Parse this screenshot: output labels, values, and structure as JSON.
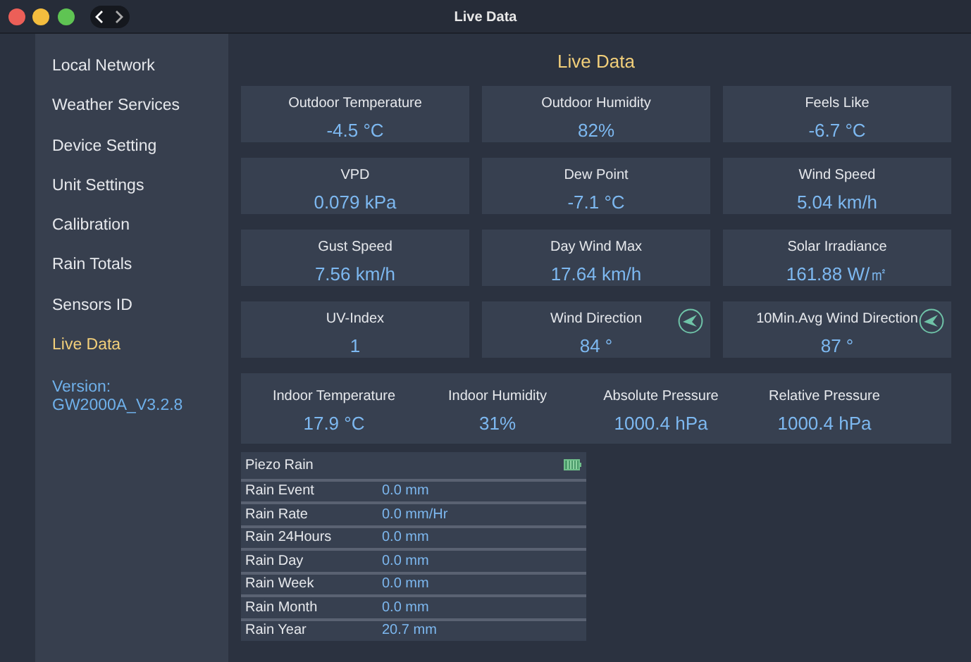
{
  "window": {
    "title": "Live Data"
  },
  "sidebar": {
    "items": [
      {
        "label": "Local Network",
        "selected": false
      },
      {
        "label": "Weather Services",
        "selected": false
      },
      {
        "label": "Device Setting",
        "selected": false
      },
      {
        "label": "Unit Settings",
        "selected": false
      },
      {
        "label": "Calibration",
        "selected": false
      },
      {
        "label": "Rain Totals",
        "selected": false
      },
      {
        "label": "Sensors ID",
        "selected": false
      },
      {
        "label": "Live Data",
        "selected": true
      }
    ],
    "version": [
      "Version:",
      "GW2000A_V3.2.8"
    ]
  },
  "main": {
    "title": "Live Data",
    "cards": [
      {
        "kind": "plain",
        "label": "Outdoor Temperature",
        "value": "-4.5 °C"
      },
      {
        "kind": "plain",
        "label": "Outdoor Humidity",
        "value": "82%"
      },
      {
        "kind": "plain",
        "label": "Feels Like",
        "value": "-6.7 °C"
      },
      {
        "kind": "plain",
        "label": "VPD",
        "value": "0.079 kPa"
      },
      {
        "kind": "plain",
        "label": "Dew Point",
        "value": "-7.1 °C"
      },
      {
        "kind": "plain",
        "label": "Wind Speed",
        "value": "5.04 km/h"
      },
      {
        "kind": "plain",
        "label": "Gust Speed",
        "value": "7.56 km/h"
      },
      {
        "kind": "plain",
        "label": "Day Wind Max",
        "value": "17.64 km/h"
      },
      {
        "kind": "plain",
        "label": "Solar Irradiance",
        "value": "161.88 W/㎡"
      },
      {
        "kind": "plain",
        "label": "UV-Index",
        "value": "1"
      },
      {
        "kind": "direction",
        "label": "Wind Direction",
        "value": "84 °"
      },
      {
        "kind": "direction",
        "label": "10Min.Avg Wind Direction",
        "value": "87 °"
      }
    ],
    "indoor": [
      {
        "label": "Indoor Temperature",
        "value": "17.9 °C"
      },
      {
        "label": "Indoor Humidity",
        "value": "31%"
      },
      {
        "label": "Absolute Pressure",
        "value": "1000.4 hPa"
      },
      {
        "label": "Relative Pressure",
        "value": "1000.4 hPa"
      }
    ],
    "rain": {
      "title": "Piezo Rain",
      "rows": [
        {
          "label": "Rain Event",
          "value": "0.0 mm"
        },
        {
          "label": "Rain Rate",
          "value": "0.0 mm/Hr"
        },
        {
          "label": "Rain 24Hours",
          "value": "0.0 mm"
        },
        {
          "label": "Rain Day",
          "value": "0.0 mm"
        },
        {
          "label": "Rain Week",
          "value": "0.0 mm"
        },
        {
          "label": "Rain Month",
          "value": "0.0 mm"
        },
        {
          "label": "Rain Year",
          "value": "20.7 mm"
        }
      ]
    }
  }
}
